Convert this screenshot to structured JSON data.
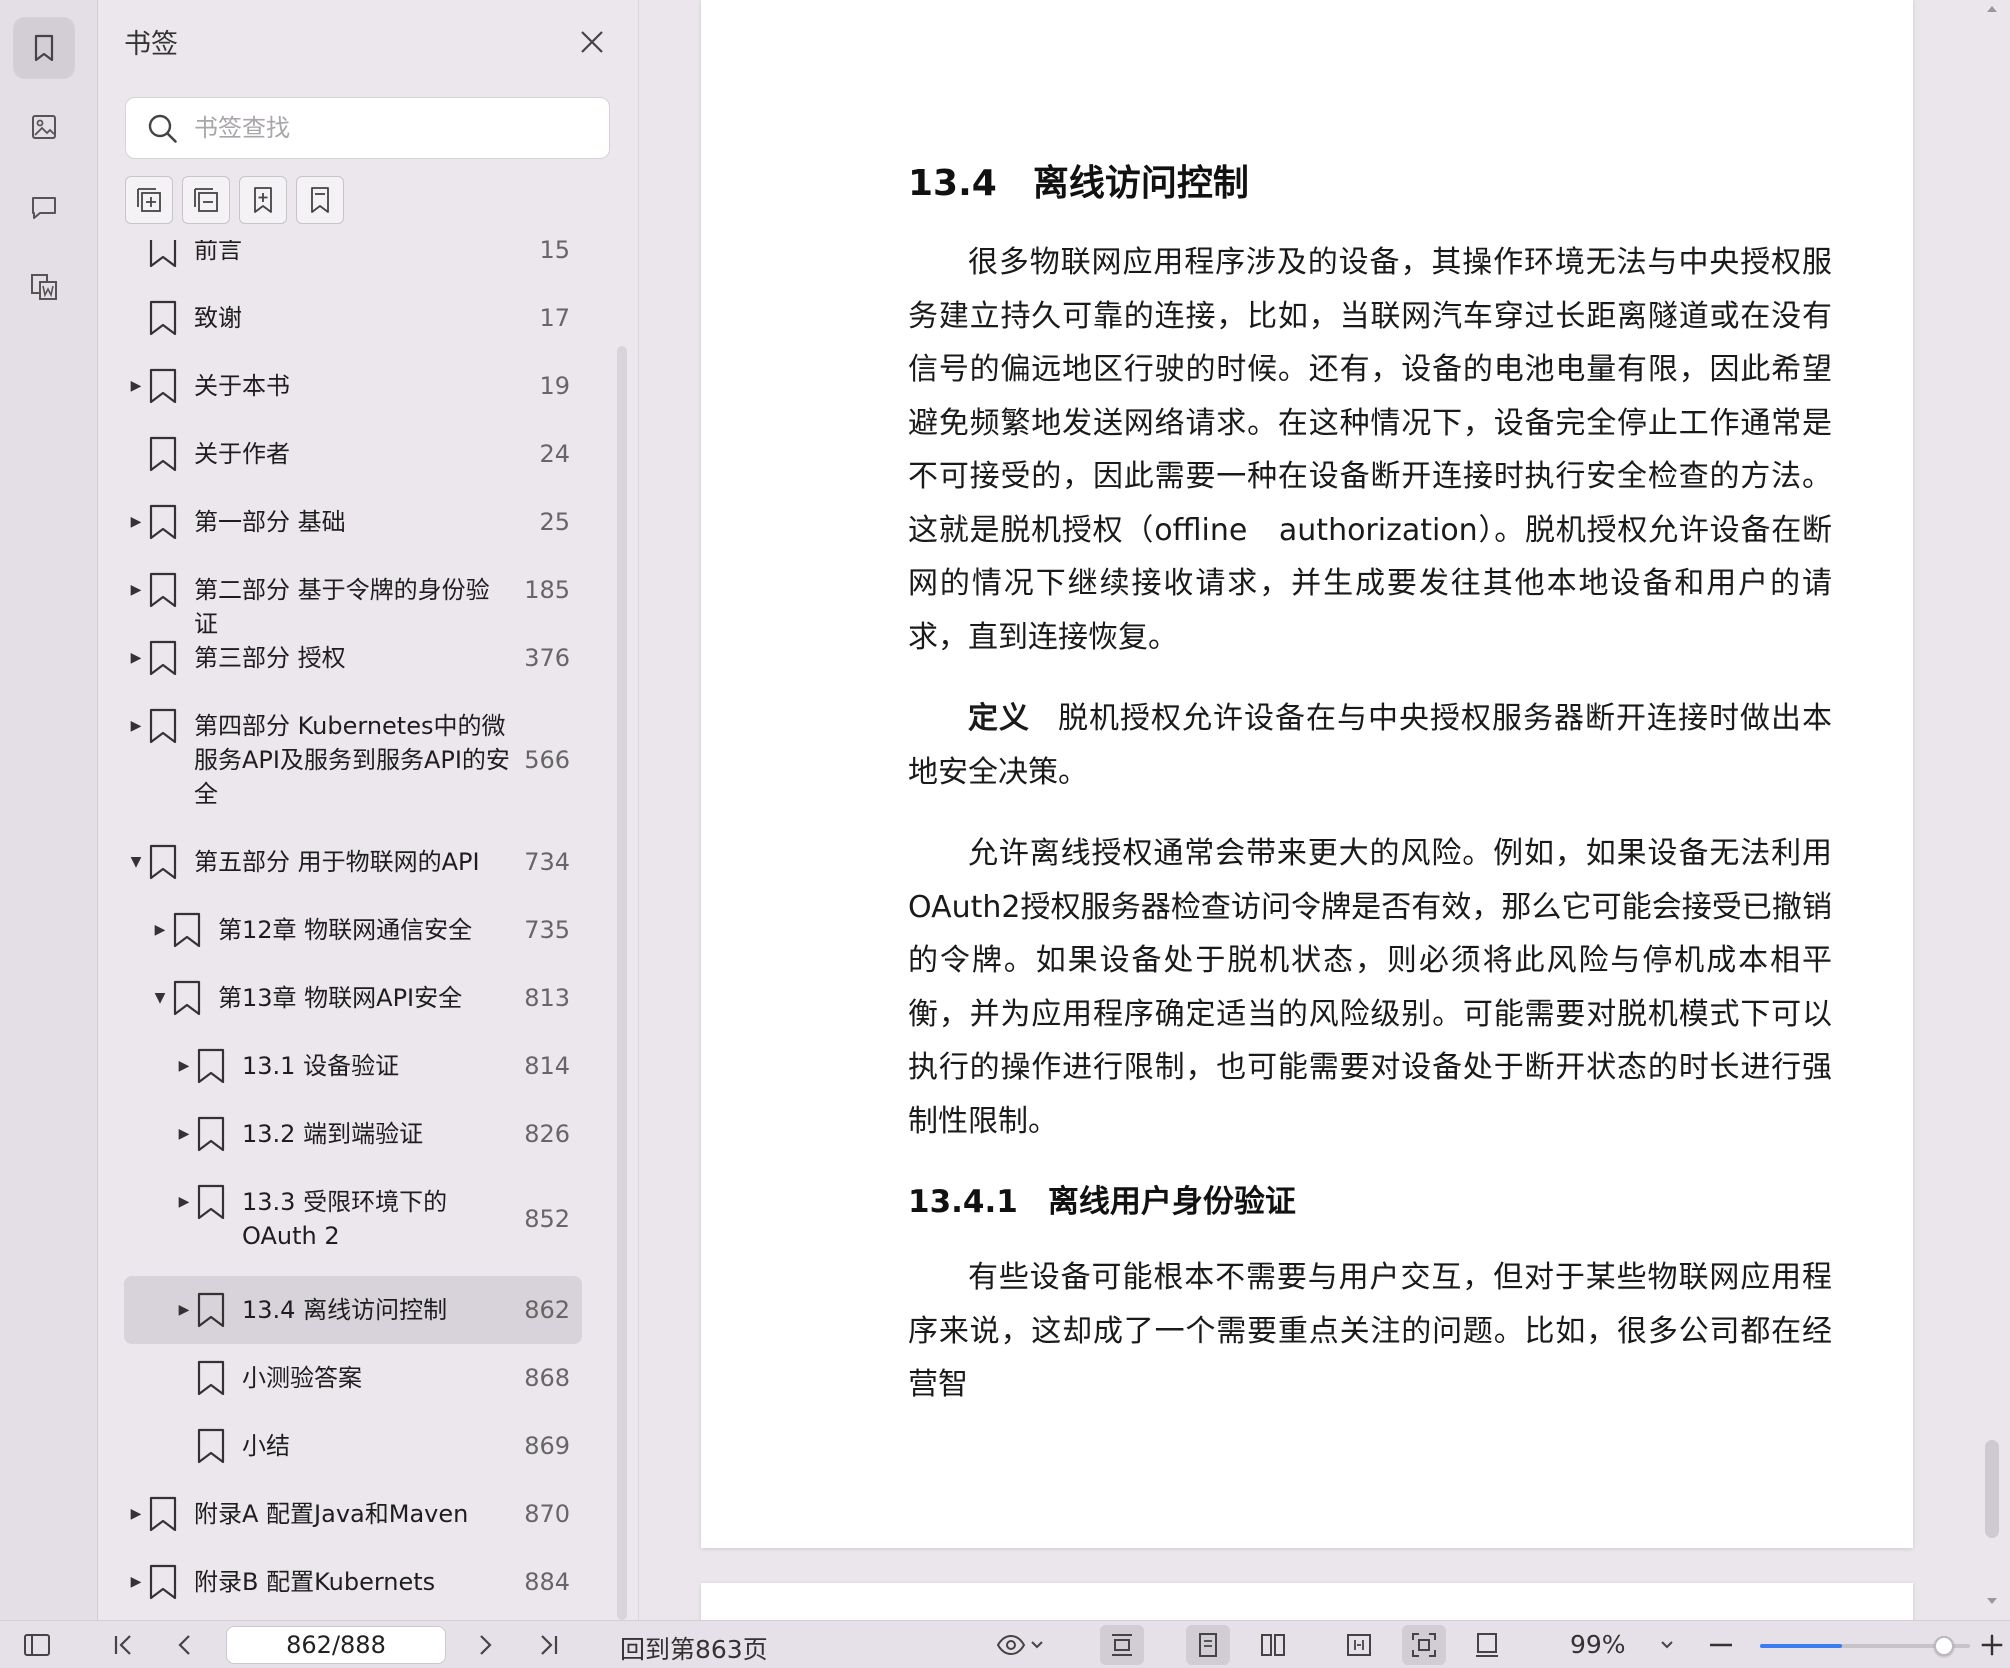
{
  "rail": {
    "items": [
      {
        "icon": "bookmark-icon",
        "active": true
      },
      {
        "icon": "thumbnail-image-icon",
        "active": false
      },
      {
        "icon": "comment-icon",
        "active": false
      },
      {
        "icon": "convert-to-word-icon",
        "active": false
      }
    ]
  },
  "panel": {
    "title": "书签",
    "search_placeholder": "书签查找",
    "tools": [
      "expand-all-icon",
      "collapse-all-icon",
      "add-bookmark-icon",
      "bookmark-outline-icon"
    ]
  },
  "bookmarks": [
    {
      "label": "前言",
      "page": "15",
      "level": 0,
      "arrow": "",
      "partial": true
    },
    {
      "label": "致谢",
      "page": "17",
      "level": 0,
      "arrow": ""
    },
    {
      "label": "关于本书",
      "page": "19",
      "level": 0,
      "arrow": "right"
    },
    {
      "label": "关于作者",
      "page": "24",
      "level": 0,
      "arrow": ""
    },
    {
      "label": "第一部分 基础",
      "page": "25",
      "level": 0,
      "arrow": "right"
    },
    {
      "label": "第二部分 基于令牌的身份验证",
      "page": "185",
      "level": 0,
      "arrow": "right"
    },
    {
      "label": "第三部分 授权",
      "page": "376",
      "level": 0,
      "arrow": "right"
    },
    {
      "label": "第四部分 Kubernetes中的微服务API及服务到服务API的安全",
      "page": "566",
      "level": 0,
      "arrow": "right",
      "lines": 3
    },
    {
      "label": "第五部分 用于物联网的API",
      "page": "734",
      "level": 0,
      "arrow": "down"
    },
    {
      "label": "第12章 物联网通信安全",
      "page": "735",
      "level": 1,
      "arrow": "right"
    },
    {
      "label": "第13章 物联网API安全",
      "page": "813",
      "level": 1,
      "arrow": "down"
    },
    {
      "label": "13.1 设备验证",
      "page": "814",
      "level": 2,
      "arrow": "right"
    },
    {
      "label": "13.2 端到端验证",
      "page": "826",
      "level": 2,
      "arrow": "right"
    },
    {
      "label": "13.3 受限环境下的OAuth 2",
      "page": "852",
      "level": 2,
      "arrow": "right",
      "lines": 2
    },
    {
      "label": "13.4 离线访问控制",
      "page": "862",
      "level": 2,
      "arrow": "right",
      "selected": true
    },
    {
      "label": "小测验答案",
      "page": "868",
      "level": 2,
      "arrow": ""
    },
    {
      "label": "小结",
      "page": "869",
      "level": 2,
      "arrow": ""
    },
    {
      "label": "附录A 配置Java和Maven",
      "page": "870",
      "level": 0,
      "arrow": "right"
    },
    {
      "label": "附录B 配置Kubernets",
      "page": "884",
      "level": 0,
      "arrow": "right"
    }
  ],
  "document": {
    "h2_num": "13.4",
    "h2_title": "离线访问控制",
    "p1": "很多物联网应用程序涉及的设备，其操作环境无法与中央授权服务建立持久可靠的连接，比如，当联网汽车穿过长距离隧道或在没有信号的偏远地区行驶的时候。还有，设备的电池电量有限，因此希望避免频繁地发送网络请求。在这种情况下，设备完全停止工作通常是不可接受的，因此需要一种在设备断开连接时执行安全检查的方法。这就是脱机授权（offline　authorization）。脱机授权允许设备在断网的情况下继续接收请求，并生成要发往其他本地设备和用户的请求，直到连接恢复。",
    "def_label": "定义",
    "def_text": "脱机授权允许设备在与中央授权服务器断开连接时做出本地安全决策。",
    "p2": "允许离线授权通常会带来更大的风险。例如，如果设备无法利用OAuth2授权服务器检查访问令牌是否有效，那么它可能会接受已撤销的令牌。如果设备处于脱机状态，则必须将此风险与停机成本相平衡，并为应用程序确定适当的风险级别。可能需要对脱机模式下可以执行的操作进行限制，也可能需要对设备处于断开状态的时长进行强制性限制。",
    "h3_num": "13.4.1",
    "h3_title": "离线用户身份验证",
    "p3": "有些设备可能根本不需要与用户交互，但对于某些物联网应用程序来说，这却成了一个需要重点关注的问题。比如，很多公司都在经营智"
  },
  "statusbar": {
    "page_value": "862/888",
    "goto_label": "回到第863页",
    "zoom_label": "99%",
    "zoom_fraction": 0.39,
    "accent_color": "#3d7bf0"
  }
}
